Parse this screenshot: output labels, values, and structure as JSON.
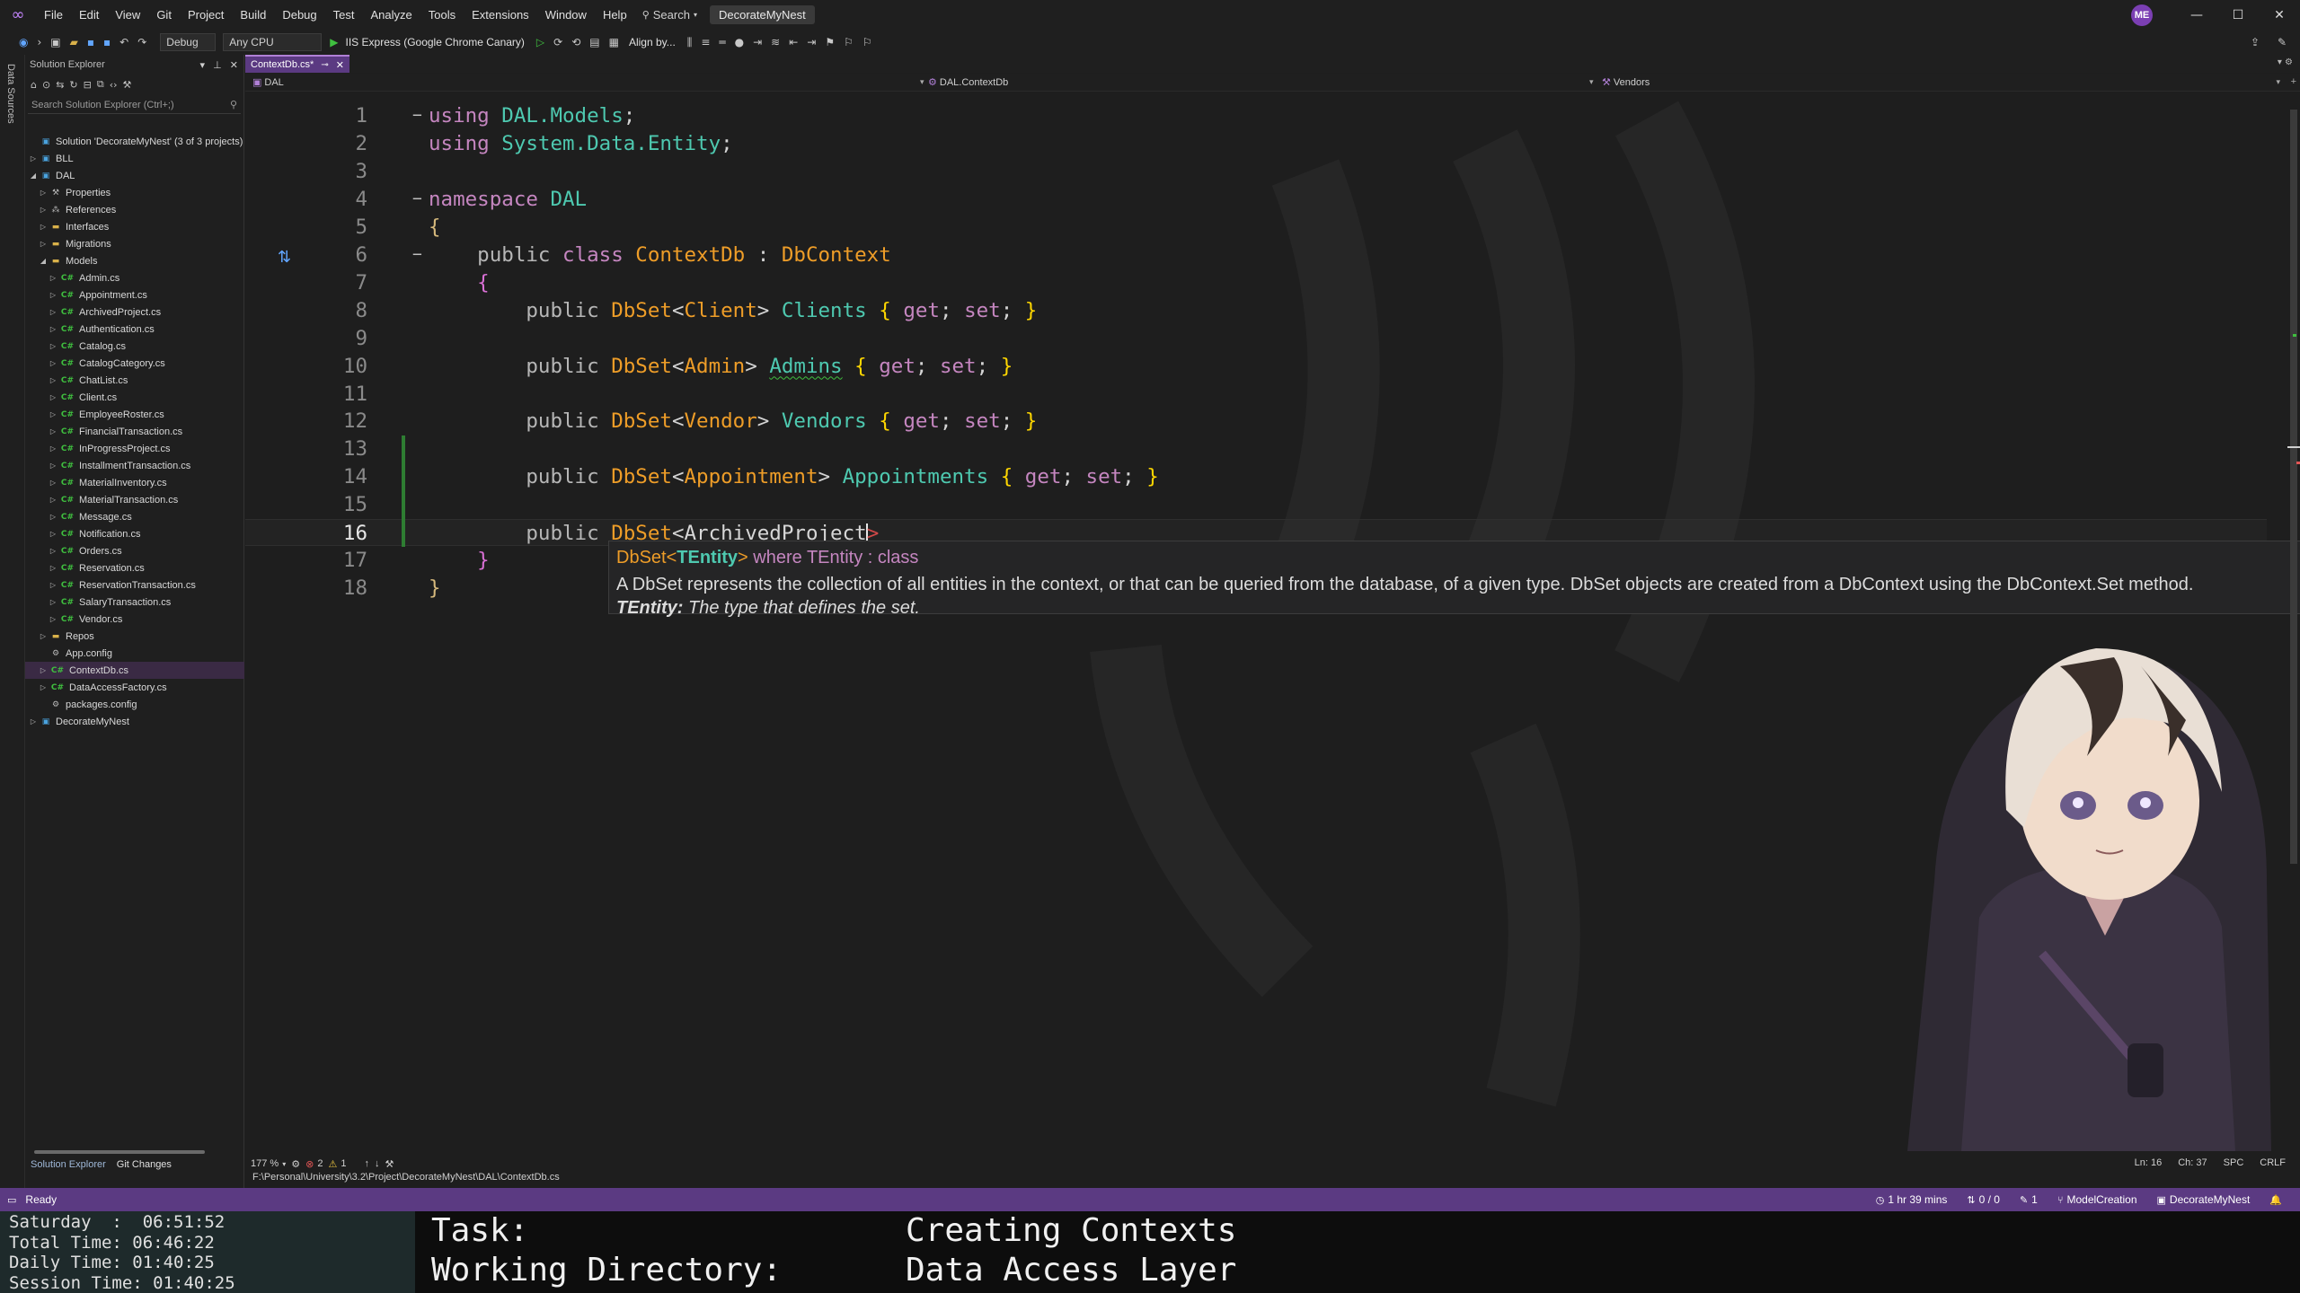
{
  "menubar": {
    "items": [
      "File",
      "Edit",
      "View",
      "Git",
      "Project",
      "Build",
      "Debug",
      "Test",
      "Analyze",
      "Tools",
      "Extensions",
      "Window",
      "Help"
    ],
    "search_label": "Search",
    "solution_name": "DecorateMyNest",
    "user_initials": "ME"
  },
  "toolbar": {
    "config": "Debug",
    "platform": "Any CPU",
    "run_target": "IIS Express (Google Chrome Canary)",
    "align_label": "Align by..."
  },
  "side_strip": {
    "label": "Data Sources"
  },
  "solution_explorer": {
    "title": "Solution Explorer",
    "search_placeholder": "Search Solution Explorer (Ctrl+;)",
    "tree": [
      {
        "label": "Solution 'DecorateMyNest' (3 of 3 projects)",
        "level": 0,
        "icon": "solution",
        "expander": ""
      },
      {
        "label": "BLL",
        "level": 0,
        "icon": "project",
        "expander": "▷"
      },
      {
        "label": "DAL",
        "level": 0,
        "icon": "project",
        "expander": "◢"
      },
      {
        "label": "Properties",
        "level": 1,
        "icon": "wrench",
        "expander": "▷"
      },
      {
        "label": "References",
        "level": 1,
        "icon": "references",
        "expander": "▷"
      },
      {
        "label": "Interfaces",
        "level": 1,
        "icon": "folder",
        "expander": "▷"
      },
      {
        "label": "Migrations",
        "level": 1,
        "icon": "folder",
        "expander": "▷"
      },
      {
        "label": "Models",
        "level": 1,
        "icon": "folder",
        "expander": "◢"
      },
      {
        "label": "Admin.cs",
        "level": 2,
        "icon": "cs",
        "expander": "▷"
      },
      {
        "label": "Appointment.cs",
        "level": 2,
        "icon": "cs",
        "expander": "▷"
      },
      {
        "label": "ArchivedProject.cs",
        "level": 2,
        "icon": "cs",
        "expander": "▷"
      },
      {
        "label": "Authentication.cs",
        "level": 2,
        "icon": "cs",
        "expander": "▷"
      },
      {
        "label": "Catalog.cs",
        "level": 2,
        "icon": "cs",
        "expander": "▷"
      },
      {
        "label": "CatalogCategory.cs",
        "level": 2,
        "icon": "cs",
        "expander": "▷"
      },
      {
        "label": "ChatList.cs",
        "level": 2,
        "icon": "cs",
        "expander": "▷"
      },
      {
        "label": "Client.cs",
        "level": 2,
        "icon": "cs",
        "expander": "▷"
      },
      {
        "label": "EmployeeRoster.cs",
        "level": 2,
        "icon": "cs",
        "expander": "▷"
      },
      {
        "label": "FinancialTransaction.cs",
        "level": 2,
        "icon": "cs",
        "expander": "▷"
      },
      {
        "label": "InProgressProject.cs",
        "level": 2,
        "icon": "cs",
        "expander": "▷"
      },
      {
        "label": "InstallmentTransaction.cs",
        "level": 2,
        "icon": "cs",
        "expander": "▷"
      },
      {
        "label": "MaterialInventory.cs",
        "level": 2,
        "icon": "cs",
        "expander": "▷"
      },
      {
        "label": "MaterialTransaction.cs",
        "level": 2,
        "icon": "cs",
        "expander": "▷"
      },
      {
        "label": "Message.cs",
        "level": 2,
        "icon": "cs",
        "expander": "▷"
      },
      {
        "label": "Notification.cs",
        "level": 2,
        "icon": "cs",
        "expander": "▷"
      },
      {
        "label": "Orders.cs",
        "level": 2,
        "icon": "cs",
        "expander": "▷"
      },
      {
        "label": "Reservation.cs",
        "level": 2,
        "icon": "cs",
        "expander": "▷"
      },
      {
        "label": "ReservationTransaction.cs",
        "level": 2,
        "icon": "cs",
        "expander": "▷"
      },
      {
        "label": "SalaryTransaction.cs",
        "level": 2,
        "icon": "cs",
        "expander": "▷"
      },
      {
        "label": "Vendor.cs",
        "level": 2,
        "icon": "cs",
        "expander": "▷"
      },
      {
        "label": "Repos",
        "level": 1,
        "icon": "folder",
        "expander": "▷"
      },
      {
        "label": "App.config",
        "level": 1,
        "icon": "config",
        "expander": ""
      },
      {
        "label": "ContextDb.cs",
        "level": 1,
        "icon": "cs",
        "expander": "▷",
        "selected": true
      },
      {
        "label": "DataAccessFactory.cs",
        "level": 1,
        "icon": "cs",
        "expander": "▷"
      },
      {
        "label": "packages.config",
        "level": 1,
        "icon": "config",
        "expander": ""
      },
      {
        "label": "DecorateMyNest",
        "level": 0,
        "icon": "project",
        "expander": "▷"
      }
    ],
    "bottom_tabs": [
      "Solution Explorer",
      "Git Changes"
    ]
  },
  "editor": {
    "tab_label": "ContextDb.cs*",
    "nav_project": "DAL",
    "nav_class": "DAL.ContextDb",
    "nav_member": "Vendors",
    "code_lines": [
      [
        {
          "t": "using ",
          "c": "kw"
        },
        {
          "t": "DAL.Models",
          "c": "ty2"
        },
        {
          "t": ";",
          "c": "punc"
        }
      ],
      [
        {
          "t": "using ",
          "c": "kw"
        },
        {
          "t": "System.Data.Entity",
          "c": "ty2"
        },
        {
          "t": ";",
          "c": "punc"
        }
      ],
      [],
      [
        {
          "t": "namespace ",
          "c": "kw"
        },
        {
          "t": "DAL",
          "c": "ty2"
        }
      ],
      [
        {
          "t": "{",
          "c": "p1"
        }
      ],
      [
        {
          "t": "    public ",
          "c": "mod"
        },
        {
          "t": "class ",
          "c": "kw"
        },
        {
          "t": "ContextDb",
          "c": "ty"
        },
        {
          "t": " : ",
          "c": "punc"
        },
        {
          "t": "DbContext",
          "c": "ty"
        }
      ],
      [
        {
          "t": "    {",
          "c": "p2"
        }
      ],
      [
        {
          "t": "        public ",
          "c": "mod"
        },
        {
          "t": "DbSet",
          "c": "ty"
        },
        {
          "t": "<",
          "c": "punc"
        },
        {
          "t": "Client",
          "c": "ty"
        },
        {
          "t": "> ",
          "c": "punc"
        },
        {
          "t": "Clients",
          "c": "prop"
        },
        {
          "t": " { ",
          "c": "p3"
        },
        {
          "t": "get",
          "c": "acc"
        },
        {
          "t": "; ",
          "c": "punc"
        },
        {
          "t": "set",
          "c": "acc"
        },
        {
          "t": "; ",
          "c": "punc"
        },
        {
          "t": "}",
          "c": "p3"
        }
      ],
      [],
      [
        {
          "t": "        public ",
          "c": "mod"
        },
        {
          "t": "DbSet",
          "c": "ty"
        },
        {
          "t": "<",
          "c": "punc"
        },
        {
          "t": "Admin",
          "c": "ty"
        },
        {
          "t": "> ",
          "c": "punc"
        },
        {
          "t": "Admins",
          "c": "prop squig"
        },
        {
          "t": " { ",
          "c": "p3"
        },
        {
          "t": "get",
          "c": "acc"
        },
        {
          "t": "; ",
          "c": "punc"
        },
        {
          "t": "set",
          "c": "acc"
        },
        {
          "t": "; ",
          "c": "punc"
        },
        {
          "t": "}",
          "c": "p3"
        }
      ],
      [],
      [
        {
          "t": "        public ",
          "c": "mod"
        },
        {
          "t": "DbSet",
          "c": "ty"
        },
        {
          "t": "<",
          "c": "punc"
        },
        {
          "t": "Vendor",
          "c": "ty"
        },
        {
          "t": "> ",
          "c": "punc"
        },
        {
          "t": "Vendors",
          "c": "prop"
        },
        {
          "t": " { ",
          "c": "p3"
        },
        {
          "t": "get",
          "c": "acc"
        },
        {
          "t": "; ",
          "c": "punc"
        },
        {
          "t": "set",
          "c": "acc"
        },
        {
          "t": "; ",
          "c": "punc"
        },
        {
          "t": "}",
          "c": "p3"
        }
      ],
      [],
      [
        {
          "t": "        public ",
          "c": "mod"
        },
        {
          "t": "DbSet",
          "c": "ty"
        },
        {
          "t": "<",
          "c": "punc"
        },
        {
          "t": "Appointment",
          "c": "ty"
        },
        {
          "t": "> ",
          "c": "punc"
        },
        {
          "t": "Appointments",
          "c": "prop"
        },
        {
          "t": " { ",
          "c": "p3"
        },
        {
          "t": "get",
          "c": "acc"
        },
        {
          "t": "; ",
          "c": "punc"
        },
        {
          "t": "set",
          "c": "acc"
        },
        {
          "t": "; ",
          "c": "punc"
        },
        {
          "t": "}",
          "c": "p3"
        }
      ],
      [],
      [
        {
          "t": "        public ",
          "c": "mod"
        },
        {
          "t": "DbSet",
          "c": "ty"
        },
        {
          "t": "<",
          "c": "punc"
        },
        {
          "t": "ArchivedProject",
          "c": "nm"
        },
        {
          "t": "|",
          "c": "caret"
        },
        {
          "t": ">",
          "c": "gt"
        }
      ],
      [
        {
          "t": "    }",
          "c": "p2"
        }
      ],
      [
        {
          "t": "}",
          "c": "p1"
        }
      ]
    ],
    "current_line": 16,
    "tooltip": {
      "sig_type": "DbSet<",
      "sig_param": "TEntity",
      "sig_close": ">",
      "sig_where": " where TEntity : class",
      "description": "A DbSet represents the collection of all entities in the context, or that can be queried from the database, of a given type. DbSet objects are created from a DbContext using the DbContext.Set method.",
      "param_name": "TEntity:",
      "param_desc": " The type that defines the set."
    },
    "status": {
      "zoom": "177 %",
      "errors": "2",
      "warnings": "1",
      "line": "Ln: 16",
      "col": "Ch: 37",
      "spaces": "SPC",
      "eol": "CRLF"
    },
    "file_path": "F:\\Personal\\University\\3.2\\Project\\DecorateMyNest\\DAL\\ContextDb.cs"
  },
  "statusbar": {
    "ready": "Ready",
    "timer": "1 hr 39 mins",
    "sync": "0 / 0",
    "edits": "1",
    "branch": "ModelCreation",
    "repo": "DecorateMyNest"
  },
  "overlay": {
    "left_rows": [
      "Saturday  :  06:51:52",
      "Total Time: 06:46:22",
      "Daily Time: 01:40:25",
      "Session Time: 01:40:25"
    ],
    "task_label": "Task:",
    "task_value": "Creating Contexts",
    "dir_label": "Working Directory:",
    "dir_value": "Data Access Layer"
  },
  "colors": {
    "accent": "#5b3a82",
    "editor_bg": "#1e1e1e",
    "type": "#ee9d28",
    "keyword": "#c586c0",
    "property": "#4ec9b0"
  }
}
